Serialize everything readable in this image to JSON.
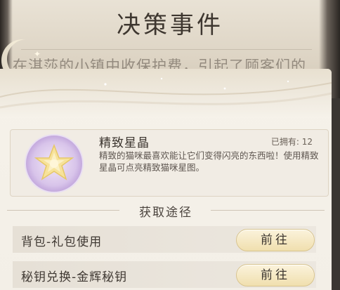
{
  "event": {
    "title": "决策事件",
    "text": "在淇莎的小镇中收保护费，引起了顾客们的"
  },
  "item": {
    "name": "精致星晶",
    "owned": "已拥有: 12",
    "description": "精致的猫咪最喜欢能让它们变得闪亮的东西啦！使用精致星晶可点亮精致猫咪星图。",
    "icon": "star-crystal-icon"
  },
  "obtain": {
    "title": "获取途径",
    "routes": [
      {
        "label": "背包-礼包使用",
        "button": "前往"
      },
      {
        "label": "秘钥兑换-金辉秘钥",
        "button": "前往"
      }
    ]
  },
  "colors": {
    "panel": "#f6f2ea",
    "button": "#f0dfae",
    "icon_bg": "#d8c4ea"
  }
}
